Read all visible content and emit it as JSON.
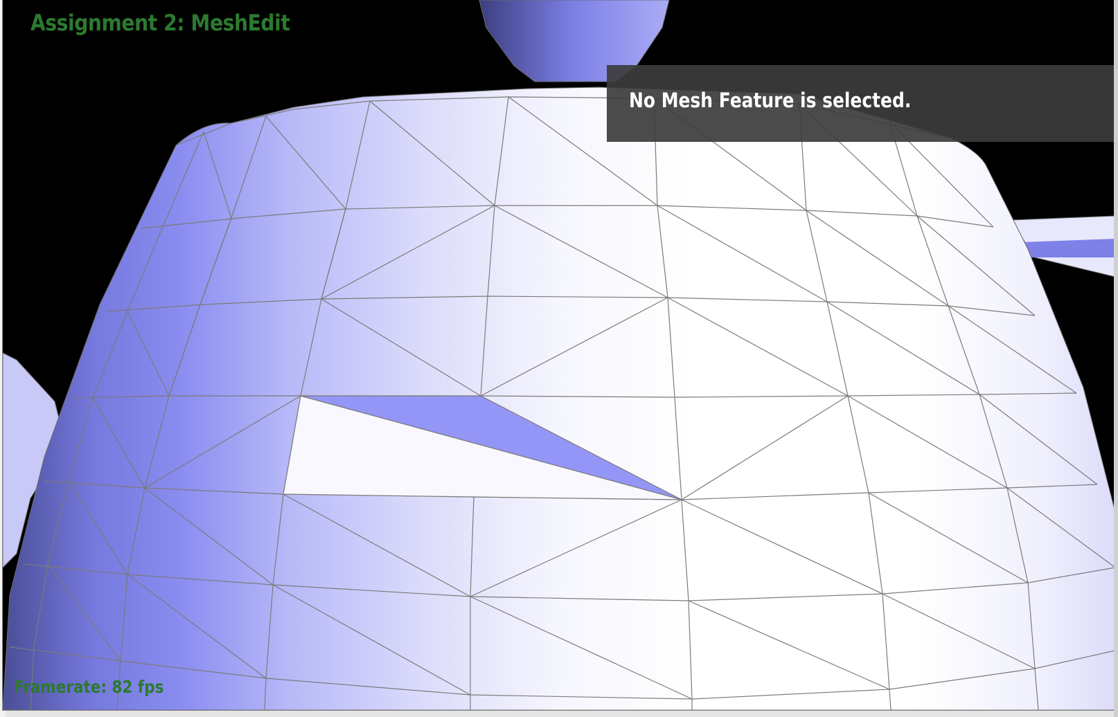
{
  "window": {
    "title": "Assignment 2: MeshEdit"
  },
  "info_panel": {
    "message": "No Mesh Feature is selected."
  },
  "status": {
    "framerate": "Framerate: 82 fps"
  },
  "colors": {
    "title_green": "#2c7a2f",
    "mesh_light": "#ffffff",
    "mesh_shade": "#8c8ff2",
    "edge": "#6a6a6a",
    "panel": "#3c3c3c"
  }
}
